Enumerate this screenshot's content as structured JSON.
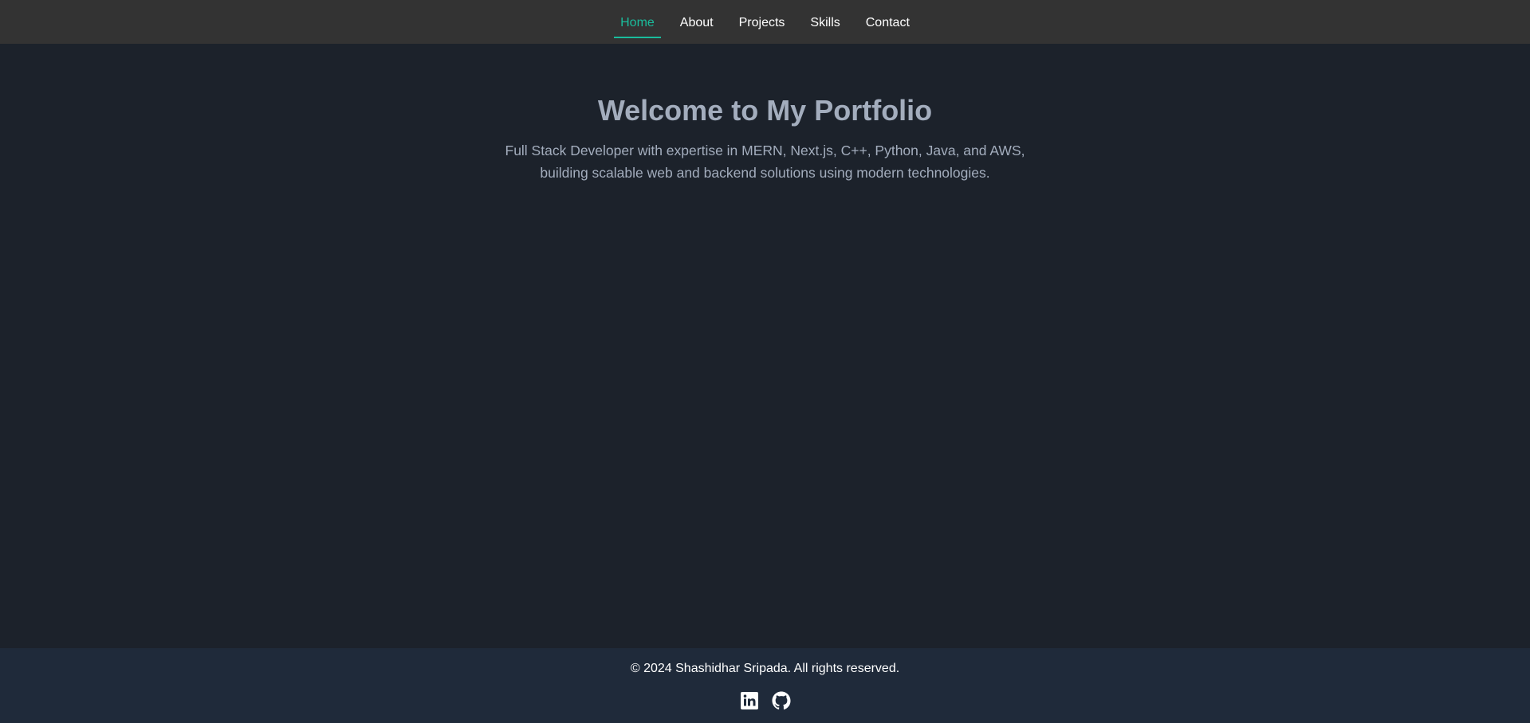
{
  "nav": {
    "items": [
      {
        "label": "Home",
        "active": true
      },
      {
        "label": "About",
        "active": false
      },
      {
        "label": "Projects",
        "active": false
      },
      {
        "label": "Skills",
        "active": false
      },
      {
        "label": "Contact",
        "active": false
      }
    ]
  },
  "hero": {
    "title": "Welcome to My Portfolio",
    "subtitle": "Full Stack Developer with expertise in MERN, Next.js, C++, Python, Java, and AWS, building scalable web and backend solutions using modern technologies."
  },
  "footer": {
    "copyright": "© 2024 Shashidhar Sripada. All rights reserved.",
    "social": [
      {
        "icon": "linkedin-icon"
      },
      {
        "icon": "github-icon"
      }
    ]
  },
  "colors": {
    "nav_bg": "#333333",
    "accent": "#1abc9c",
    "main_bg": "#1c222b",
    "text_muted": "#a3adbd",
    "footer_bg": "#1f2a3a"
  }
}
